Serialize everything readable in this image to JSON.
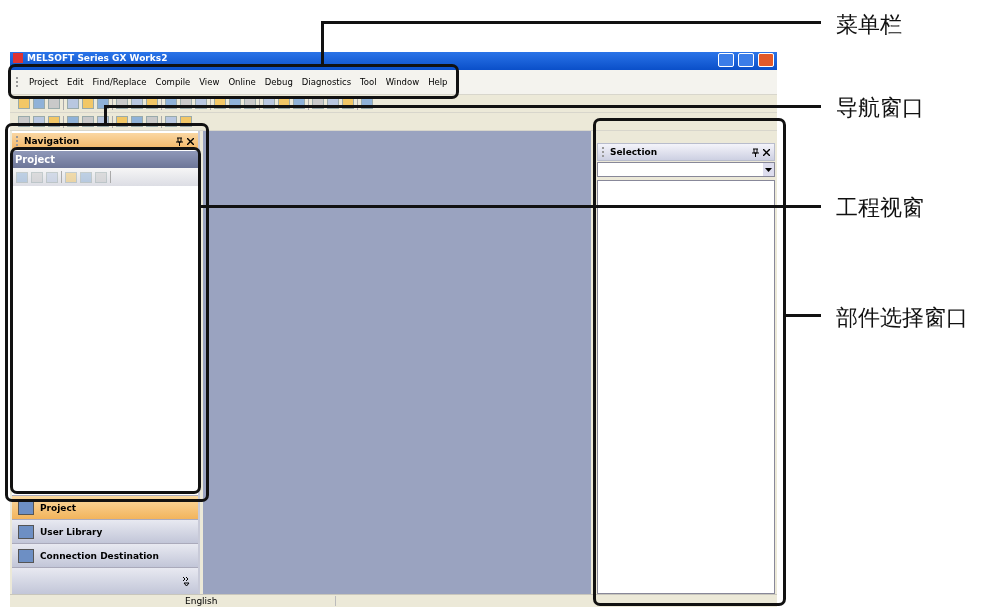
{
  "window": {
    "title": "MELSOFT Series GX Works2"
  },
  "menu": [
    {
      "label": "Project"
    },
    {
      "label": "Edit"
    },
    {
      "label": "Find/Replace"
    },
    {
      "label": "Compile"
    },
    {
      "label": "View"
    },
    {
      "label": "Online"
    },
    {
      "label": "Debug"
    },
    {
      "label": "Diagnostics"
    },
    {
      "label": "Tool"
    },
    {
      "label": "Window"
    },
    {
      "label": "Help"
    }
  ],
  "navigation": {
    "title": "Navigation",
    "project_view": {
      "title": "Project"
    },
    "buttons": [
      {
        "label": "Project",
        "selected": true
      },
      {
        "label": "User Library",
        "selected": false
      },
      {
        "label": "Connection Destination",
        "selected": false
      }
    ]
  },
  "selection": {
    "title": "Selection"
  },
  "status_bar": {
    "language": "English"
  },
  "annotations": [
    {
      "label": "菜单栏"
    },
    {
      "label": "导航窗口"
    },
    {
      "label": "工程视窗"
    },
    {
      "label": "部件选择窗口"
    }
  ]
}
